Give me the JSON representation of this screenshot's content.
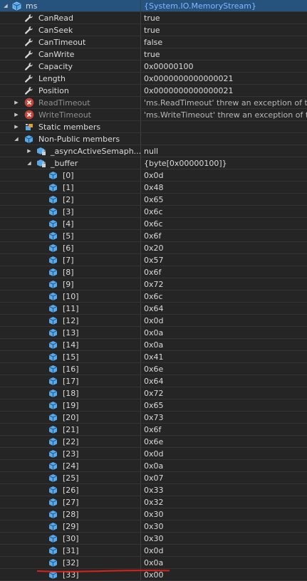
{
  "header": {
    "name": "ms",
    "value": "{System.IO.MemoryStream}"
  },
  "properties": [
    {
      "name": "CanRead",
      "value": "true"
    },
    {
      "name": "CanSeek",
      "value": "true"
    },
    {
      "name": "CanTimeout",
      "value": "false"
    },
    {
      "name": "CanWrite",
      "value": "true"
    },
    {
      "name": "Capacity",
      "value": "0x00000100"
    },
    {
      "name": "Length",
      "value": "0x0000000000000021"
    },
    {
      "name": "Position",
      "value": "0x0000000000000021"
    }
  ],
  "errors": [
    {
      "name": "ReadTimeout",
      "value": "'ms.ReadTimeout' threw an exception of type"
    },
    {
      "name": "WriteTimeout",
      "value": "'ms.WriteTimeout' threw an exception of type"
    }
  ],
  "static_members": {
    "label": "Static members"
  },
  "non_public": {
    "label": "Non-Public members",
    "async_field": {
      "name": "_asyncActiveSemaph...",
      "value": "null"
    },
    "buffer": {
      "name": "_buffer",
      "value": "{byte[0x00000100]}",
      "items": [
        {
          "index": "[0]",
          "value": "0x0d"
        },
        {
          "index": "[1]",
          "value": "0x48"
        },
        {
          "index": "[2]",
          "value": "0x65"
        },
        {
          "index": "[3]",
          "value": "0x6c"
        },
        {
          "index": "[4]",
          "value": "0x6c"
        },
        {
          "index": "[5]",
          "value": "0x6f"
        },
        {
          "index": "[6]",
          "value": "0x20"
        },
        {
          "index": "[7]",
          "value": "0x57"
        },
        {
          "index": "[8]",
          "value": "0x6f"
        },
        {
          "index": "[9]",
          "value": "0x72"
        },
        {
          "index": "[10]",
          "value": "0x6c"
        },
        {
          "index": "[11]",
          "value": "0x64"
        },
        {
          "index": "[12]",
          "value": "0x0d"
        },
        {
          "index": "[13]",
          "value": "0x0a"
        },
        {
          "index": "[14]",
          "value": "0x0a"
        },
        {
          "index": "[15]",
          "value": "0x41"
        },
        {
          "index": "[16]",
          "value": "0x6e"
        },
        {
          "index": "[17]",
          "value": "0x64"
        },
        {
          "index": "[18]",
          "value": "0x72"
        },
        {
          "index": "[19]",
          "value": "0x65"
        },
        {
          "index": "[20]",
          "value": "0x73"
        },
        {
          "index": "[21]",
          "value": "0x6f"
        },
        {
          "index": "[22]",
          "value": "0x6e"
        },
        {
          "index": "[23]",
          "value": "0x0d"
        },
        {
          "index": "[24]",
          "value": "0x0a"
        },
        {
          "index": "[25]",
          "value": "0x07"
        },
        {
          "index": "[26]",
          "value": "0x33"
        },
        {
          "index": "[27]",
          "value": "0x32"
        },
        {
          "index": "[28]",
          "value": "0x30"
        },
        {
          "index": "[29]",
          "value": "0x30"
        },
        {
          "index": "[30]",
          "value": "0x30"
        },
        {
          "index": "[31]",
          "value": "0x0d"
        },
        {
          "index": "[32]",
          "value": "0x0a"
        },
        {
          "index": "[33]",
          "value": "0x00"
        }
      ]
    }
  },
  "colors": {
    "background": "#252526",
    "selected_row": "#26527e",
    "error_icon": "#c5453a",
    "field_icon": "#59a8e8",
    "annotation_underline": "#e0201a"
  },
  "icons": {
    "property": "wrench-icon",
    "error": "error-circle-icon",
    "field": "cube-field-icon",
    "static": "static-members-icon",
    "expand": "triangle-right-icon",
    "collapse": "triangle-down-icon"
  }
}
